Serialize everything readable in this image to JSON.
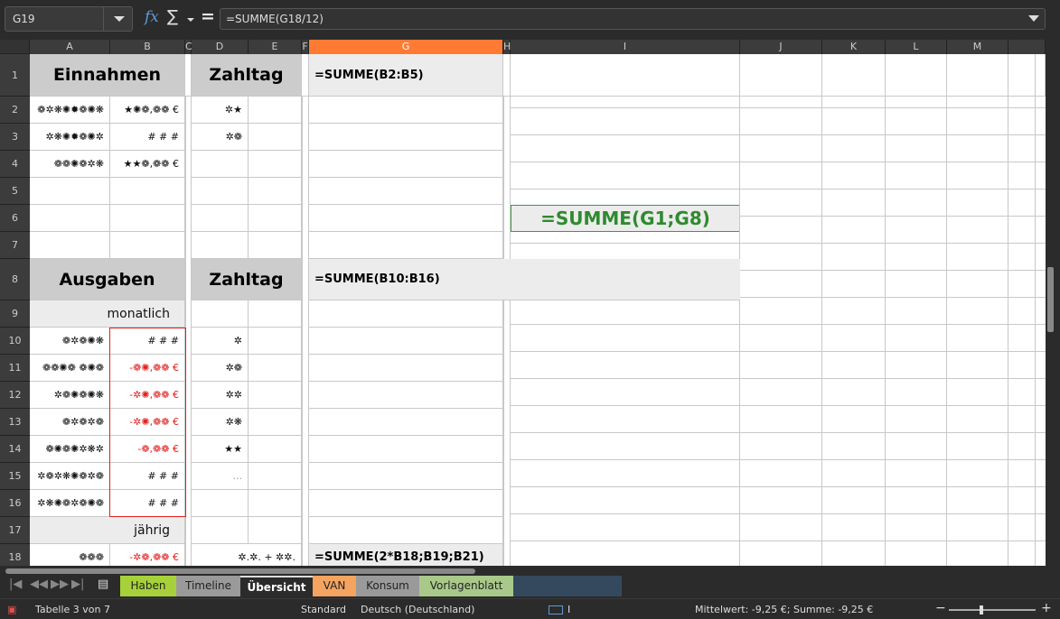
{
  "formula_bar": {
    "name_box": "G19",
    "fx": "fx",
    "sigma": "∑",
    "equals": "=",
    "formula": "=SUMME(G18/12)"
  },
  "columns": [
    "A",
    "B",
    "C",
    "D",
    "E",
    "F",
    "G",
    "H",
    "I",
    "J",
    "K",
    "L",
    "M"
  ],
  "rows": [
    "1",
    "2",
    "3",
    "4",
    "5",
    "6",
    "7",
    "8",
    "9",
    "10",
    "11",
    "12",
    "13",
    "14",
    "15",
    "16",
    "17",
    "18"
  ],
  "cells": {
    "A1": "Einnahmen",
    "D1": "Zahltag",
    "G1": "=SUMME(B2:B5)",
    "A2": "❁✲❋✺✹❁✺❋",
    "B2": "★✺❁,❁❁ €",
    "D2": "✲★",
    "A3": "✲❋✺✹❁✺✲",
    "B3": "# # #",
    "D3": "✲❁",
    "A4": "❁❁✺❁✲❋",
    "B4": "★★❁,❁❁ €",
    "D4": "",
    "I6": "=SUMME(G1;G8)",
    "A8": "Ausgaben",
    "D8": "Zahltag",
    "G8": "=SUMME(B10:B16)",
    "A9": "monatlich",
    "A10": "❁✲❁✺❋",
    "B10": "# # #",
    "D10": "✲",
    "A11": "❁❁✺❁ ❁✺❁",
    "B11": "-❁✺,❁❁ €",
    "D11": "✲❁",
    "A12": "✲❁✺❁✺❋",
    "B12": "-✲✺,❁❁ €",
    "D12": "✲✲",
    "A13": "❁✲❁✲❁",
    "B13": "-✲✺,❁❁ €",
    "D13": "✲❋",
    "A14": "❁✺❁✺✲❋✲",
    "B14": "-❁,❁❁ €",
    "D14": "★★",
    "A15": "✲❁✲❋✺❁✲❁",
    "B15": "# # #",
    "D15": "...",
    "A16": "✲❋✺❁✲❁✺❁",
    "B16": "# # #",
    "A17": "jährig",
    "A18": "❁❁❁",
    "B18": "-✲❁,❁❁ €",
    "D18": "✲.✲. + ✲✲.",
    "G18": "=SUMME(2*B18;B19;B21)"
  },
  "tabs": [
    {
      "label": "Haben",
      "color": "#a7d13a"
    },
    {
      "label": "Timeline",
      "color": "#9a9a9a"
    },
    {
      "label": "Übersicht",
      "color": "#2b2b2b"
    },
    {
      "label": "VAN",
      "color": "#f4a460"
    },
    {
      "label": "Konsum",
      "color": "#9a9a9a"
    },
    {
      "label": "Vorlagenblatt",
      "color": "#a9c98a"
    },
    {
      "label": "",
      "color": "#34495e"
    }
  ],
  "status": {
    "sheet": "Tabelle 3 von 7",
    "style": "Standard",
    "language": "Deutsch (Deutschland)",
    "summary": "Mittelwert: -9,25 €; Summe: -9,25 €",
    "zoom_minus": "−",
    "zoom_plus": "+"
  },
  "colors": {
    "accent": "#ff7a33",
    "green": "#2e8b2e",
    "red": "#e02020"
  }
}
